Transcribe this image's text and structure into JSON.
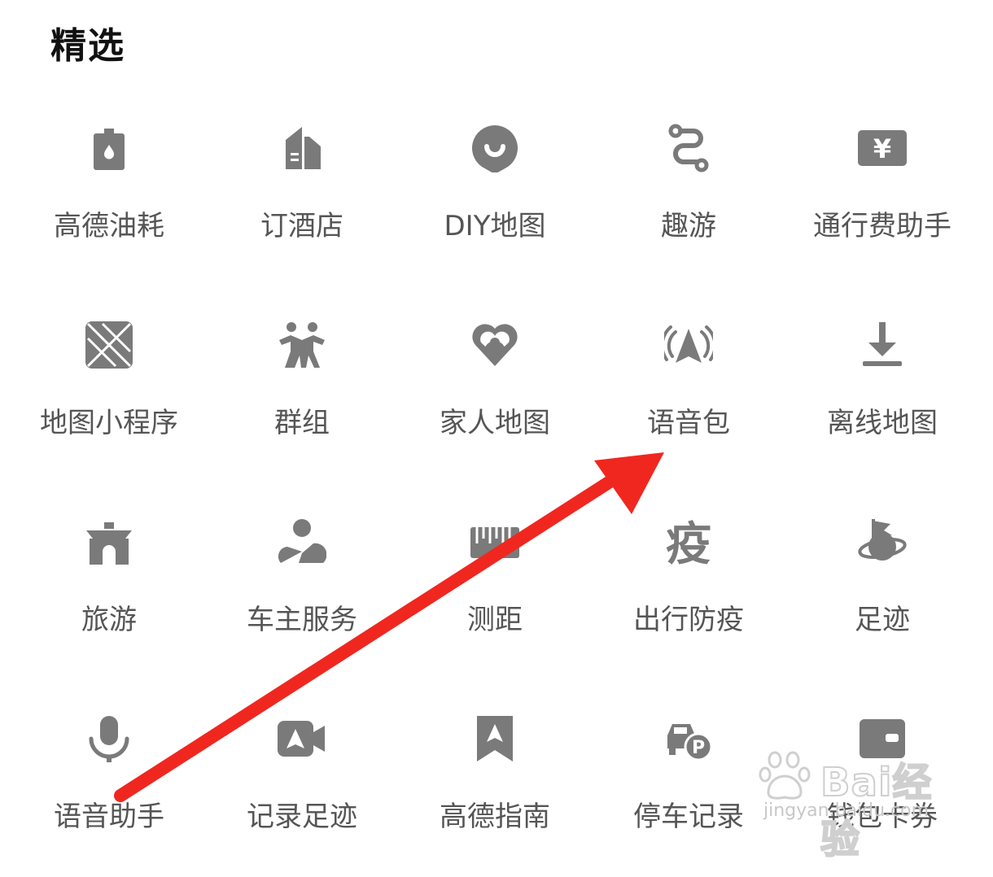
{
  "section": {
    "title": "精选"
  },
  "tiles": [
    {
      "label": "高德油耗",
      "icon": "fuel-can-icon"
    },
    {
      "label": "订酒店",
      "icon": "hotel-building-icon"
    },
    {
      "label": "DIY地图",
      "icon": "map-pin-smile-icon"
    },
    {
      "label": "趣游",
      "icon": "route-icon"
    },
    {
      "label": "通行费助手",
      "icon": "toll-yen-icon"
    },
    {
      "label": "地图小程序",
      "icon": "mini-program-icon"
    },
    {
      "label": "群组",
      "icon": "group-people-icon"
    },
    {
      "label": "家人地图",
      "icon": "family-heart-icon"
    },
    {
      "label": "语音包",
      "icon": "voice-pack-icon"
    },
    {
      "label": "离线地图",
      "icon": "download-icon"
    },
    {
      "label": "旅游",
      "icon": "pagoda-icon"
    },
    {
      "label": "车主服务",
      "icon": "car-owner-icon"
    },
    {
      "label": "测距",
      "icon": "ruler-icon"
    },
    {
      "label": "出行防疫",
      "icon": "epidemic-icon"
    },
    {
      "label": "足迹",
      "icon": "planet-flag-icon"
    },
    {
      "label": "语音助手",
      "icon": "microphone-icon"
    },
    {
      "label": "记录足迹",
      "icon": "video-record-icon"
    },
    {
      "label": "高德指南",
      "icon": "bookmark-guide-icon"
    },
    {
      "label": "停车记录",
      "icon": "car-parking-icon"
    },
    {
      "label": "钱包卡券",
      "icon": "wallet-icon"
    }
  ],
  "epidemic_glyph": "疫",
  "watermark": {
    "main": "Bai经验",
    "sub": "jingyan.baidu.com"
  },
  "colors": {
    "icon": "#7a7a7a",
    "label": "#555555",
    "title": "#111111",
    "arrow": "#f0271f"
  }
}
